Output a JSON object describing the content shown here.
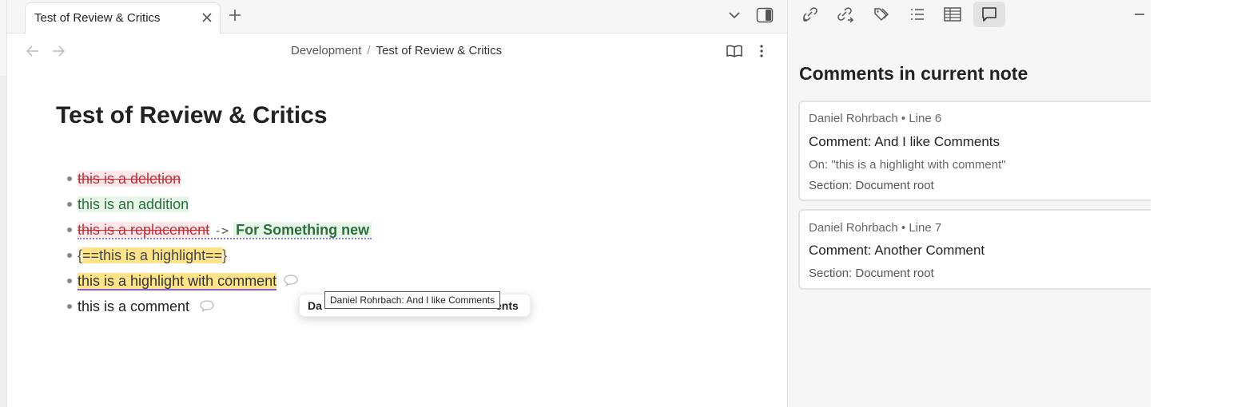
{
  "tab": {
    "title": "Test of Review & Critics"
  },
  "breadcrumb": {
    "folder": "Development",
    "separator": "/",
    "current": "Test of Review & Critics"
  },
  "note": {
    "title": "Test of Review & Critics",
    "items": {
      "deletion": "this is a deletion",
      "addition": "this is an addition",
      "replacement_old": "this is a replacement",
      "replacement_arrow": "->",
      "replacement_new": "For Something new",
      "highlight_open": "{",
      "highlight_mark_open": "==",
      "highlight_text": "this is a highlight",
      "highlight_mark_close": "==",
      "highlight_close": "}",
      "highlight_with_comment": "this is a highlight with comment",
      "comment": "this is a comment"
    }
  },
  "popover": {
    "start": "Da",
    "end": "ents"
  },
  "tooltip": {
    "text": "Daniel Rohrbach: And I like Comments"
  },
  "panel": {
    "title": "Comments in current note",
    "comments": [
      {
        "meta": "Daniel Rohrbach • Line 6",
        "body": "Comment: And I like Comments",
        "on": "On: \"this is a highlight with comment\"",
        "section": "Section: Document root"
      },
      {
        "meta": "Daniel Rohrbach • Line 7",
        "body": "Comment: Another Comment",
        "section": "Section: Document root"
      }
    ]
  },
  "toolbar_icons": [
    "backlinks-icon",
    "outgoing-links-icon",
    "tags-icon",
    "outline-icon",
    "table-icon",
    "comments-icon"
  ],
  "colors": {
    "deletion_bg": "#fde7e9",
    "deletion_text": "#b8323a",
    "addition_bg": "#e8f6ea",
    "addition_text": "#2b6e3c",
    "highlight": "#ffe38a",
    "comment_underline": "#8b5cd6"
  }
}
